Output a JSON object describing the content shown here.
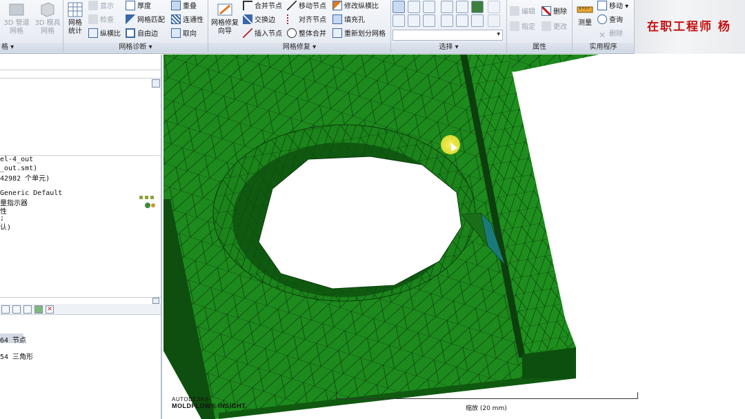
{
  "ribbon": {
    "left_cut": {
      "btn1": "3D 管道",
      "btn1b": "网格",
      "btn2": "3D 模具",
      "btn2b": "网格",
      "label": "格"
    },
    "diagnostics": {
      "label": "网格诊断",
      "big_label_1": "网格",
      "big_label_2": "统计",
      "display": "显示",
      "check": "检查",
      "aspect": "纵横比",
      "thickness": "厚度",
      "mesh_match": "网格匹配",
      "free_edge": "自由边",
      "overlap": "重叠",
      "connectivity": "连通性",
      "orient": "取向"
    },
    "repair": {
      "label": "网格修复",
      "big_label_1": "网格修复",
      "big_label_2": "向导",
      "merge_nodes": "合并节点",
      "swap_edge": "交换边",
      "insert_node": "插入节点",
      "move_node": "移动节点",
      "align_nodes": "对齐节点",
      "global_merge": "整体合并",
      "fix_aspect": "修改纵横比",
      "fill_hole": "填充孔",
      "remesh": "重新划分网格"
    },
    "selection": {
      "label": "选择"
    },
    "properties": {
      "label": "属性",
      "edit": "编辑",
      "delete": "删除",
      "assign": "指定",
      "change": "更改"
    },
    "utilities": {
      "label": "实用程序",
      "measure": "测量",
      "move": "移动",
      "query": "查询",
      "delete": "删除"
    },
    "brand": "在职工程师 杨"
  },
  "left_panel": {
    "study_name": "el-4_out",
    "file_name": "_out.smt)",
    "elements": "42982 个单元)",
    "generic": "Generic Default",
    "quality": "量指示器",
    "property": "性",
    "dots": ";",
    "default": "认)",
    "nodes": "64 节点",
    "triangles": "54 三角形"
  },
  "viewport": {
    "logo_line1": "AUTODESK®",
    "logo_line2": "MOLDFLOW® INSIGHT",
    "scale_text": "缩放 (20 mm)"
  },
  "colors": {
    "mesh": "#1d8a1d",
    "mesh_dark": "#0f5a10",
    "accent_red": "#c41010"
  }
}
